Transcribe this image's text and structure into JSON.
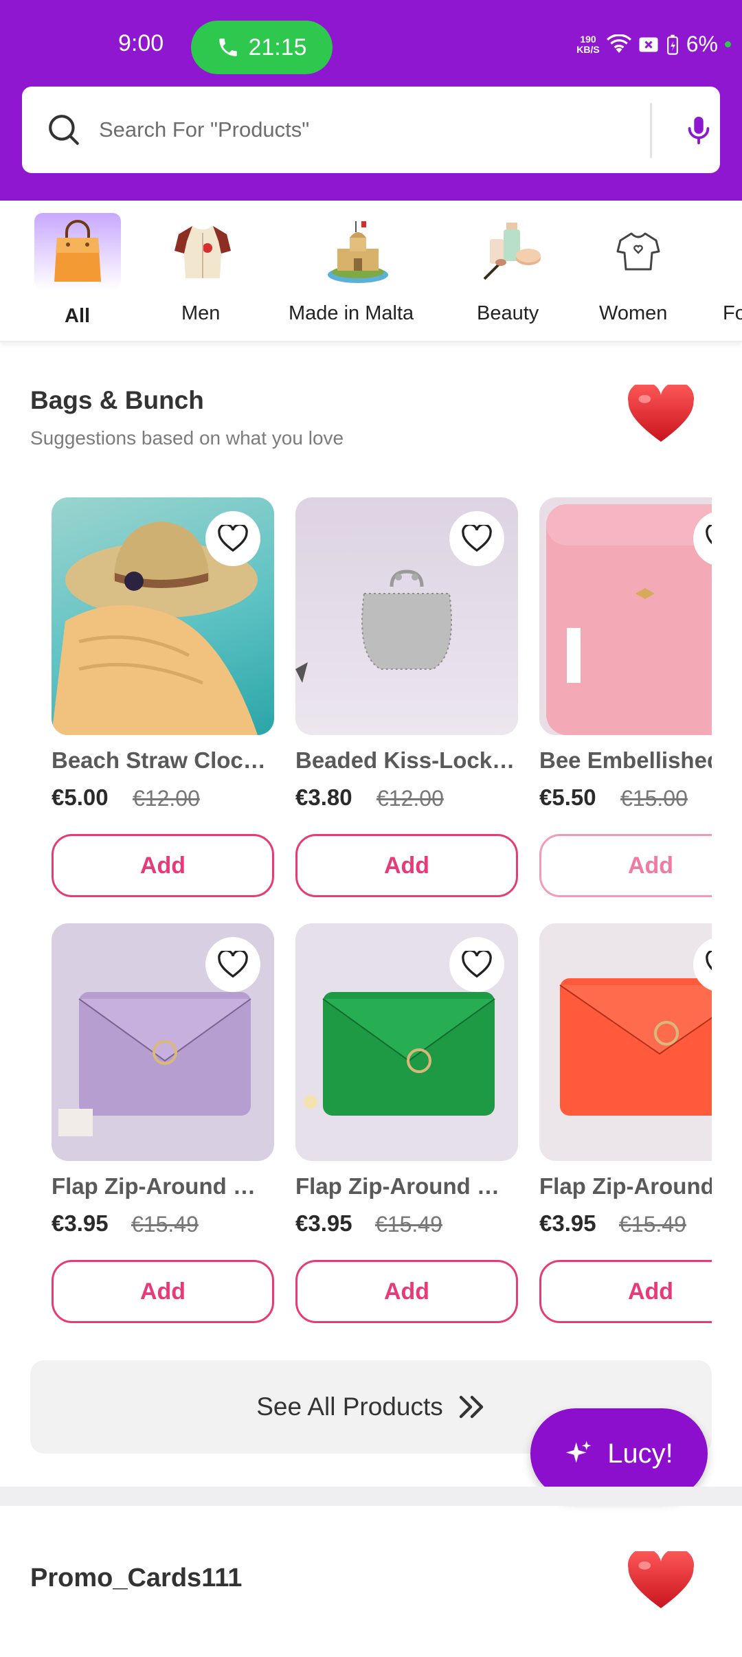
{
  "status_bar": {
    "time": "9:00",
    "call_timer": "21:15",
    "net_speed_top": "190",
    "net_speed_bottom": "KB/S",
    "battery": "6%"
  },
  "search": {
    "placeholder": "Search For \"Products\""
  },
  "categories": [
    {
      "label": "All",
      "icon": "shopping-bag-icon",
      "active": true
    },
    {
      "label": "Men",
      "icon": "shirt-icon"
    },
    {
      "label": "Made in Malta",
      "icon": "malta-castle-icon"
    },
    {
      "label": "Beauty",
      "icon": "cosmetics-icon"
    },
    {
      "label": "Women",
      "icon": "blouse-icon"
    },
    {
      "label": "Fo",
      "icon": ""
    }
  ],
  "section": {
    "title": "Bags & Bunch",
    "subtitle": "Suggestions based on what you love"
  },
  "products": [
    {
      "name": "Beach Straw Cloche Hat",
      "price": "€5.00",
      "old_price": "€12.00",
      "add": "Add"
    },
    {
      "name": "Beaded Kiss-Lock Coin Purse",
      "price": "€3.80",
      "old_price": "€12.00",
      "add": "Add"
    },
    {
      "name": "Bee Embellished Crossbody",
      "price": "€5.50",
      "old_price": "€15.00",
      "add": "Add"
    },
    {
      "name": "Flap Zip-Around Wallet",
      "price": "€3.95",
      "old_price": "€15.49",
      "add": "Add"
    },
    {
      "name": "Flap Zip-Around Wallet",
      "price": "€3.95",
      "old_price": "€15.49",
      "add": "Add"
    },
    {
      "name": "Flap Zip-Around Wallet",
      "price": "€3.95",
      "old_price": "€15.49",
      "add": "Add"
    }
  ],
  "see_all": "See All Products",
  "assistant_button": "Lucy!",
  "section2": {
    "title": "Promo_Cards111"
  },
  "colors": {
    "brand_purple": "#8e17cf",
    "accent_pink": "#e83a79",
    "call_green": "#2dc84d"
  }
}
